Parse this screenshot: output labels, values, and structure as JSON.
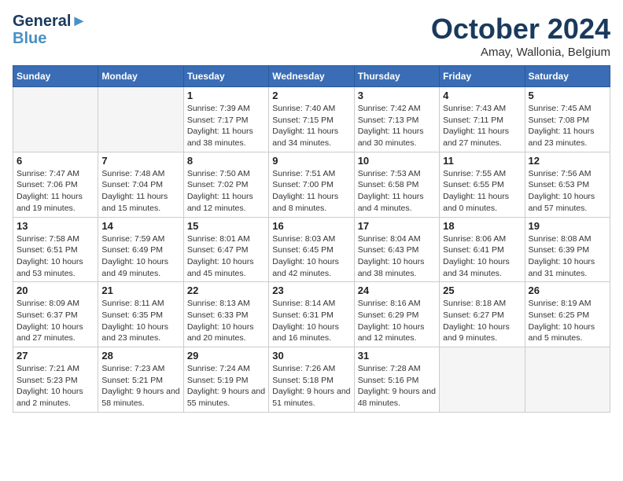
{
  "header": {
    "logo_line1": "General",
    "logo_line2": "Blue",
    "month_title": "October 2024",
    "location": "Amay, Wallonia, Belgium"
  },
  "weekdays": [
    "Sunday",
    "Monday",
    "Tuesday",
    "Wednesday",
    "Thursday",
    "Friday",
    "Saturday"
  ],
  "weeks": [
    [
      {
        "day": "",
        "empty": true
      },
      {
        "day": "",
        "empty": true
      },
      {
        "day": "1",
        "sunrise": "7:39 AM",
        "sunset": "7:17 PM",
        "daylight": "11 hours and 38 minutes."
      },
      {
        "day": "2",
        "sunrise": "7:40 AM",
        "sunset": "7:15 PM",
        "daylight": "11 hours and 34 minutes."
      },
      {
        "day": "3",
        "sunrise": "7:42 AM",
        "sunset": "7:13 PM",
        "daylight": "11 hours and 30 minutes."
      },
      {
        "day": "4",
        "sunrise": "7:43 AM",
        "sunset": "7:11 PM",
        "daylight": "11 hours and 27 minutes."
      },
      {
        "day": "5",
        "sunrise": "7:45 AM",
        "sunset": "7:08 PM",
        "daylight": "11 hours and 23 minutes."
      }
    ],
    [
      {
        "day": "6",
        "sunrise": "7:47 AM",
        "sunset": "7:06 PM",
        "daylight": "11 hours and 19 minutes."
      },
      {
        "day": "7",
        "sunrise": "7:48 AM",
        "sunset": "7:04 PM",
        "daylight": "11 hours and 15 minutes."
      },
      {
        "day": "8",
        "sunrise": "7:50 AM",
        "sunset": "7:02 PM",
        "daylight": "11 hours and 12 minutes."
      },
      {
        "day": "9",
        "sunrise": "7:51 AM",
        "sunset": "7:00 PM",
        "daylight": "11 hours and 8 minutes."
      },
      {
        "day": "10",
        "sunrise": "7:53 AM",
        "sunset": "6:58 PM",
        "daylight": "11 hours and 4 minutes."
      },
      {
        "day": "11",
        "sunrise": "7:55 AM",
        "sunset": "6:55 PM",
        "daylight": "11 hours and 0 minutes."
      },
      {
        "day": "12",
        "sunrise": "7:56 AM",
        "sunset": "6:53 PM",
        "daylight": "10 hours and 57 minutes."
      }
    ],
    [
      {
        "day": "13",
        "sunrise": "7:58 AM",
        "sunset": "6:51 PM",
        "daylight": "10 hours and 53 minutes."
      },
      {
        "day": "14",
        "sunrise": "7:59 AM",
        "sunset": "6:49 PM",
        "daylight": "10 hours and 49 minutes."
      },
      {
        "day": "15",
        "sunrise": "8:01 AM",
        "sunset": "6:47 PM",
        "daylight": "10 hours and 45 minutes."
      },
      {
        "day": "16",
        "sunrise": "8:03 AM",
        "sunset": "6:45 PM",
        "daylight": "10 hours and 42 minutes."
      },
      {
        "day": "17",
        "sunrise": "8:04 AM",
        "sunset": "6:43 PM",
        "daylight": "10 hours and 38 minutes."
      },
      {
        "day": "18",
        "sunrise": "8:06 AM",
        "sunset": "6:41 PM",
        "daylight": "10 hours and 34 minutes."
      },
      {
        "day": "19",
        "sunrise": "8:08 AM",
        "sunset": "6:39 PM",
        "daylight": "10 hours and 31 minutes."
      }
    ],
    [
      {
        "day": "20",
        "sunrise": "8:09 AM",
        "sunset": "6:37 PM",
        "daylight": "10 hours and 27 minutes."
      },
      {
        "day": "21",
        "sunrise": "8:11 AM",
        "sunset": "6:35 PM",
        "daylight": "10 hours and 23 minutes."
      },
      {
        "day": "22",
        "sunrise": "8:13 AM",
        "sunset": "6:33 PM",
        "daylight": "10 hours and 20 minutes."
      },
      {
        "day": "23",
        "sunrise": "8:14 AM",
        "sunset": "6:31 PM",
        "daylight": "10 hours and 16 minutes."
      },
      {
        "day": "24",
        "sunrise": "8:16 AM",
        "sunset": "6:29 PM",
        "daylight": "10 hours and 12 minutes."
      },
      {
        "day": "25",
        "sunrise": "8:18 AM",
        "sunset": "6:27 PM",
        "daylight": "10 hours and 9 minutes."
      },
      {
        "day": "26",
        "sunrise": "8:19 AM",
        "sunset": "6:25 PM",
        "daylight": "10 hours and 5 minutes."
      }
    ],
    [
      {
        "day": "27",
        "sunrise": "7:21 AM",
        "sunset": "5:23 PM",
        "daylight": "10 hours and 2 minutes."
      },
      {
        "day": "28",
        "sunrise": "7:23 AM",
        "sunset": "5:21 PM",
        "daylight": "9 hours and 58 minutes."
      },
      {
        "day": "29",
        "sunrise": "7:24 AM",
        "sunset": "5:19 PM",
        "daylight": "9 hours and 55 minutes."
      },
      {
        "day": "30",
        "sunrise": "7:26 AM",
        "sunset": "5:18 PM",
        "daylight": "9 hours and 51 minutes."
      },
      {
        "day": "31",
        "sunrise": "7:28 AM",
        "sunset": "5:16 PM",
        "daylight": "9 hours and 48 minutes."
      },
      {
        "day": "",
        "empty": true
      },
      {
        "day": "",
        "empty": true
      }
    ]
  ],
  "labels": {
    "sunrise": "Sunrise:",
    "sunset": "Sunset:",
    "daylight": "Daylight:"
  }
}
